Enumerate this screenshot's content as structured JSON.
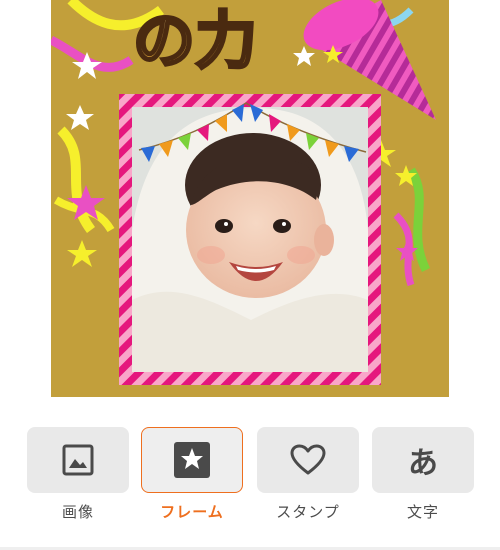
{
  "canvas": {
    "title_partial": "の力",
    "background_color": "#c29f3b",
    "frame_stripe_colors": [
      "#e5177d",
      "#f9a6c9"
    ],
    "photo_alt": "smiling baby in a white hooded towel"
  },
  "toolbar": {
    "tools": [
      {
        "label": "画像",
        "icon": "image-icon",
        "selected": false
      },
      {
        "label": "フレーム",
        "icon": "frame-star-icon",
        "selected": true
      },
      {
        "label": "スタンプ",
        "icon": "heart-icon",
        "selected": false
      },
      {
        "label": "文字",
        "icon": "text-a-icon",
        "glyph": "あ",
        "selected": false
      }
    ]
  },
  "colors": {
    "accent": "#ee6f1f",
    "tool_bg": "#e9e9e9",
    "label": "#4c4c4c"
  }
}
